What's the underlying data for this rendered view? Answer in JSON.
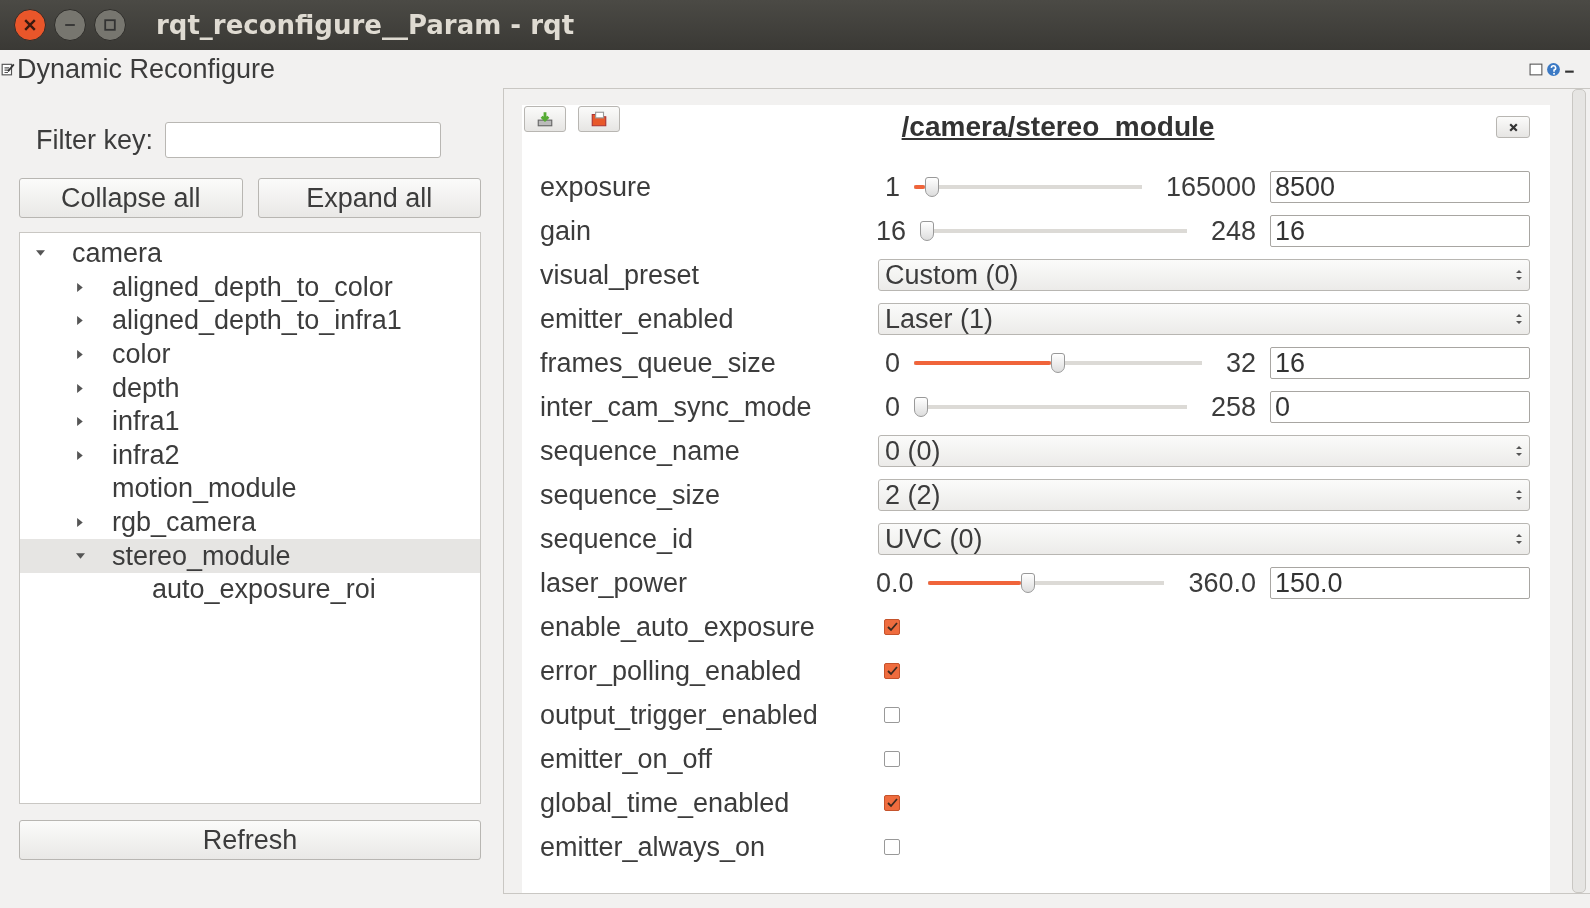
{
  "window": {
    "title": "rqt_reconfigure__Param - rqt"
  },
  "plugin": {
    "title": "Dynamic Reconfigure"
  },
  "filter": {
    "label": "Filter key:"
  },
  "buttons": [
    "Collapse all",
    "Expand all"
  ],
  "tree": [
    {
      "label": "camera",
      "expanded": true,
      "selected": false,
      "children": [
        {
          "label": "aligned_depth_to_color",
          "expanded": false,
          "selected": false
        },
        {
          "label": "aligned_depth_to_infra1",
          "expanded": false,
          "selected": false
        },
        {
          "label": "color",
          "expanded": false,
          "selected": false
        },
        {
          "label": "depth",
          "expanded": false,
          "selected": false
        },
        {
          "label": "infra1",
          "expanded": false,
          "selected": false
        },
        {
          "label": "infra2",
          "expanded": false,
          "selected": false
        },
        {
          "label": "motion_module",
          "selected": false
        },
        {
          "label": "rgb_camera",
          "expanded": false,
          "selected": false
        },
        {
          "label": "stereo_module",
          "expanded": true,
          "selected": true,
          "children": [
            {
              "label": "auto_exposure_roi",
              "selected": false
            }
          ]
        }
      ]
    }
  ],
  "refresh": "Refresh",
  "node": {
    "title": "/camera/stereo_module"
  },
  "params": [
    {
      "kind": "slider",
      "name": "exposure",
      "min": "1",
      "max": "165000",
      "level": 0.05,
      "value": "8500"
    },
    {
      "kind": "slider",
      "name": "gain",
      "min": "16",
      "max": "248",
      "level": 0,
      "value": "16"
    },
    {
      "kind": "enum",
      "name": "visual_preset",
      "value": "Custom (0)"
    },
    {
      "kind": "enum",
      "name": "emitter_enabled",
      "value": "Laser (1)"
    },
    {
      "kind": "slider",
      "name": "frames_queue_size",
      "min": "0",
      "max": "32",
      "level": 0.5,
      "value": "16"
    },
    {
      "kind": "slider",
      "name": "inter_cam_sync_mode",
      "min": "0",
      "max": "258",
      "level": 0,
      "value": "0"
    },
    {
      "kind": "enum",
      "name": "sequence_name",
      "value": "0 (0)"
    },
    {
      "kind": "enum",
      "name": "sequence_size",
      "value": "2 (2)"
    },
    {
      "kind": "enum",
      "name": "sequence_id",
      "value": "UVC (0)"
    },
    {
      "kind": "slider",
      "name": "laser_power",
      "min": "0.0",
      "max": "360.0",
      "level": 0.42,
      "value": "150.0"
    },
    {
      "kind": "check",
      "name": "enable_auto_exposure",
      "checked": true
    },
    {
      "kind": "check",
      "name": "error_polling_enabled",
      "checked": true
    },
    {
      "kind": "check",
      "name": "output_trigger_enabled",
      "checked": false
    },
    {
      "kind": "check",
      "name": "emitter_on_off",
      "checked": false
    },
    {
      "kind": "check",
      "name": "global_time_enabled",
      "checked": true
    },
    {
      "kind": "check",
      "name": "emitter_always_on",
      "checked": false
    }
  ]
}
